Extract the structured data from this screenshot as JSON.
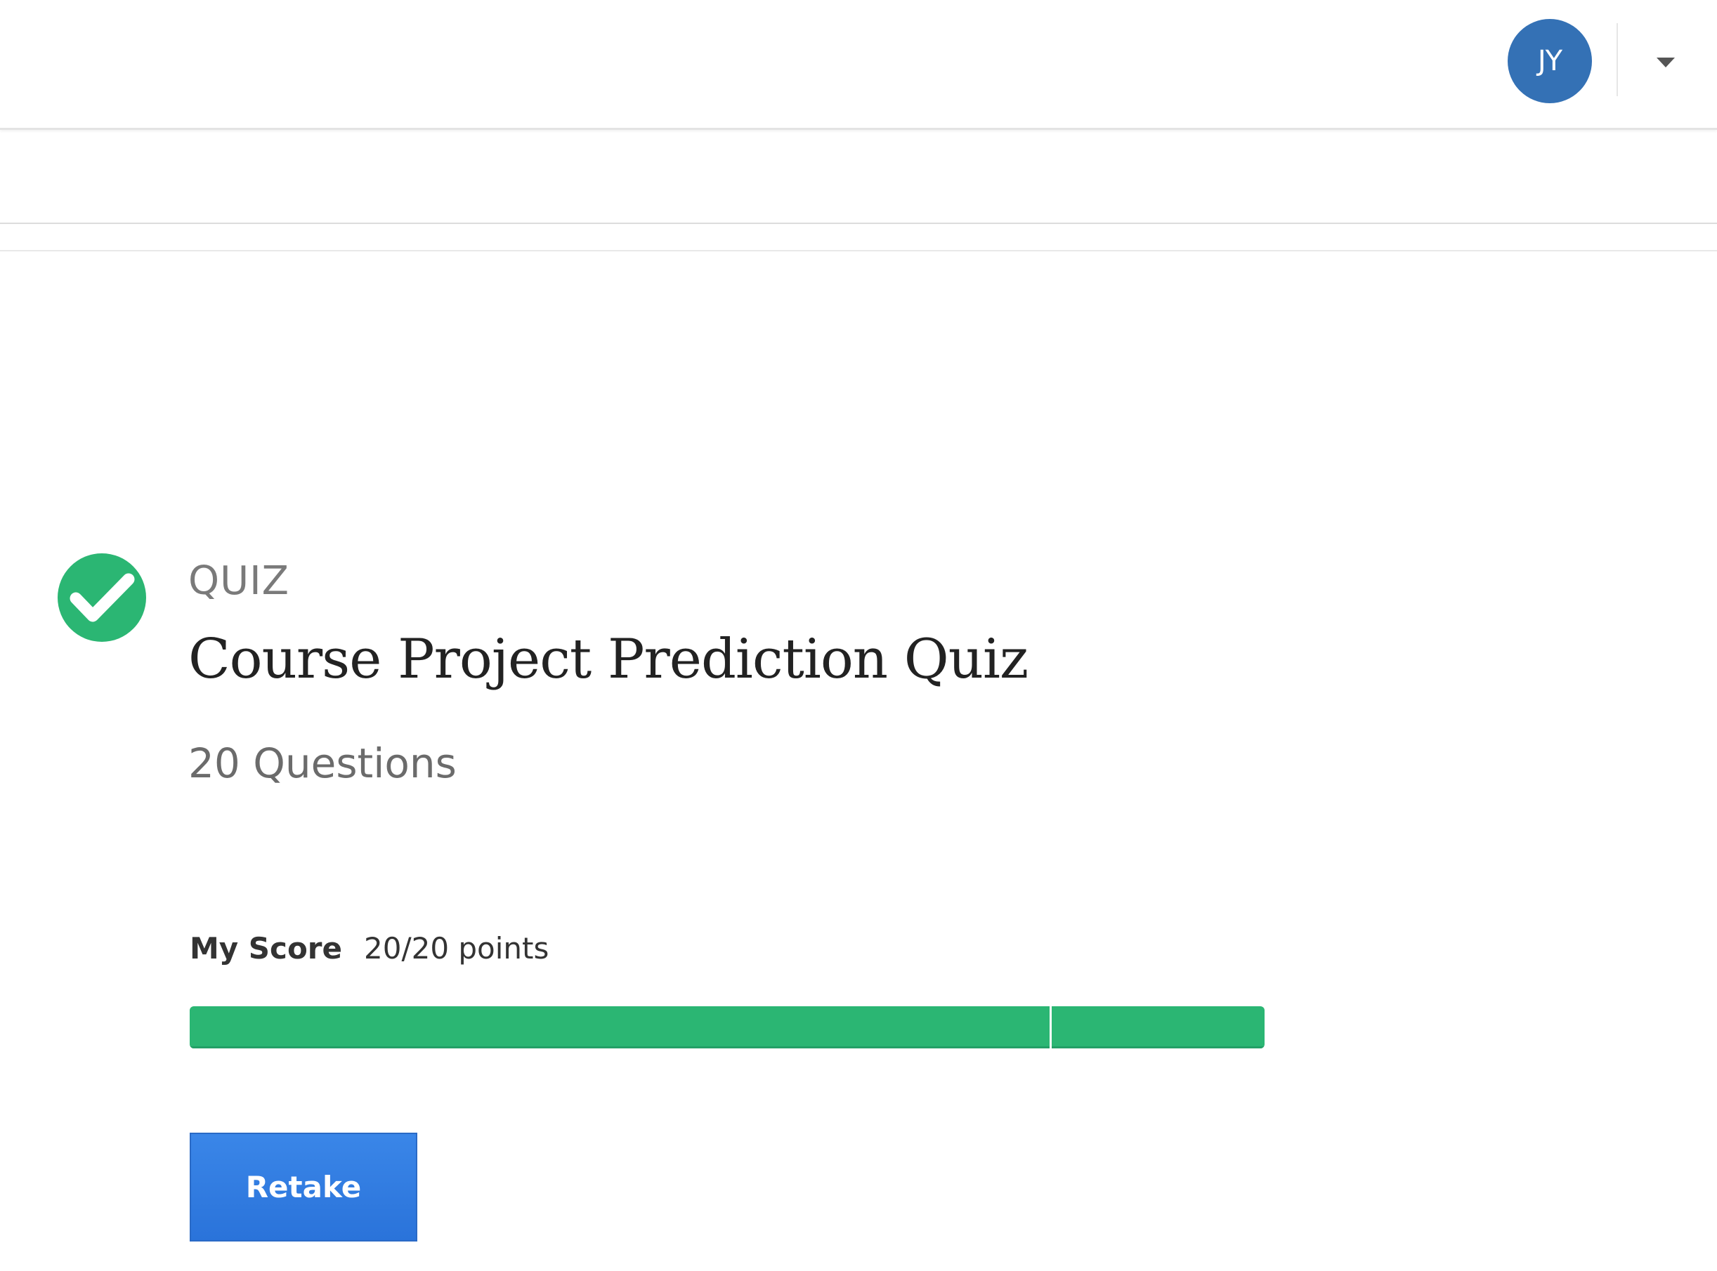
{
  "header": {
    "user_initials": "JY",
    "avatar_color": "#3471b5"
  },
  "quiz": {
    "status_icon": "check-circle-icon",
    "status_color": "#2bb673",
    "type_label": "QUIZ",
    "title": "Course Project Prediction Quiz",
    "question_count": "20 Questions"
  },
  "score": {
    "label": "My Score",
    "value": "20/20 points",
    "progress_fraction": 1.0,
    "passing_threshold_fraction": 0.8,
    "bar_color": "#2bb673"
  },
  "actions": {
    "retake_label": "Retake",
    "button_color": "#2f7be0"
  }
}
